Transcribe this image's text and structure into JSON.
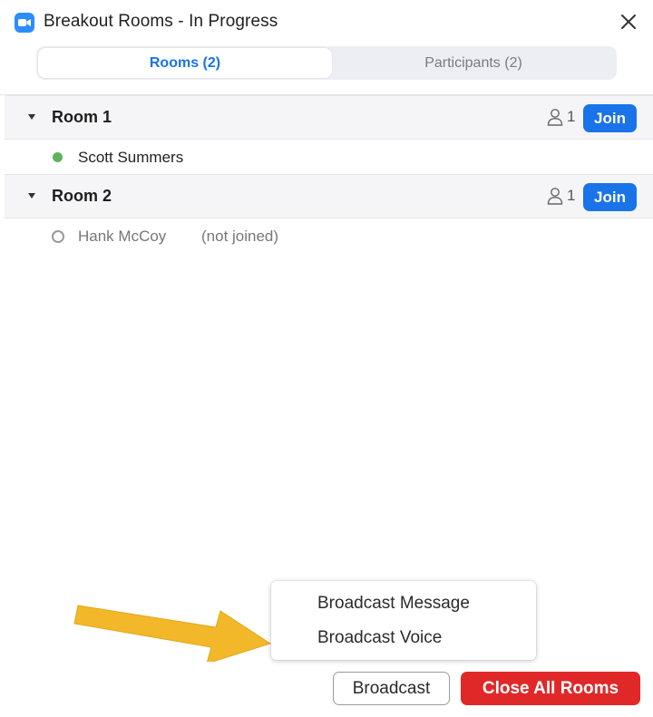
{
  "window": {
    "title": "Breakout Rooms - In Progress"
  },
  "tabs": [
    {
      "label": "Rooms (2)",
      "active": true
    },
    {
      "label": "Participants (2)",
      "active": false
    }
  ],
  "rooms": [
    {
      "name": "Room 1",
      "count": "1",
      "join_label": "Join",
      "participants": [
        {
          "name": "Scott Summers",
          "status": "",
          "joined": true
        }
      ]
    },
    {
      "name": "Room 2",
      "count": "1",
      "join_label": "Join",
      "participants": [
        {
          "name": "Hank McCoy",
          "status": "(not joined)",
          "joined": false
        }
      ]
    }
  ],
  "broadcast_menu": {
    "items": [
      "Broadcast Message",
      "Broadcast Voice"
    ]
  },
  "footer": {
    "broadcast_label": "Broadcast",
    "close_all_label": "Close All Rooms"
  },
  "colors": {
    "accent_blue": "#1a73e8",
    "danger_red": "#e02828",
    "joined_green": "#5fb35f",
    "arrow_yellow": "#f2b829"
  },
  "icons": [
    "video-camera-icon",
    "close-icon",
    "caret-down-icon",
    "person-icon",
    "status-dot-icon",
    "pointer-arrow-icon"
  ]
}
